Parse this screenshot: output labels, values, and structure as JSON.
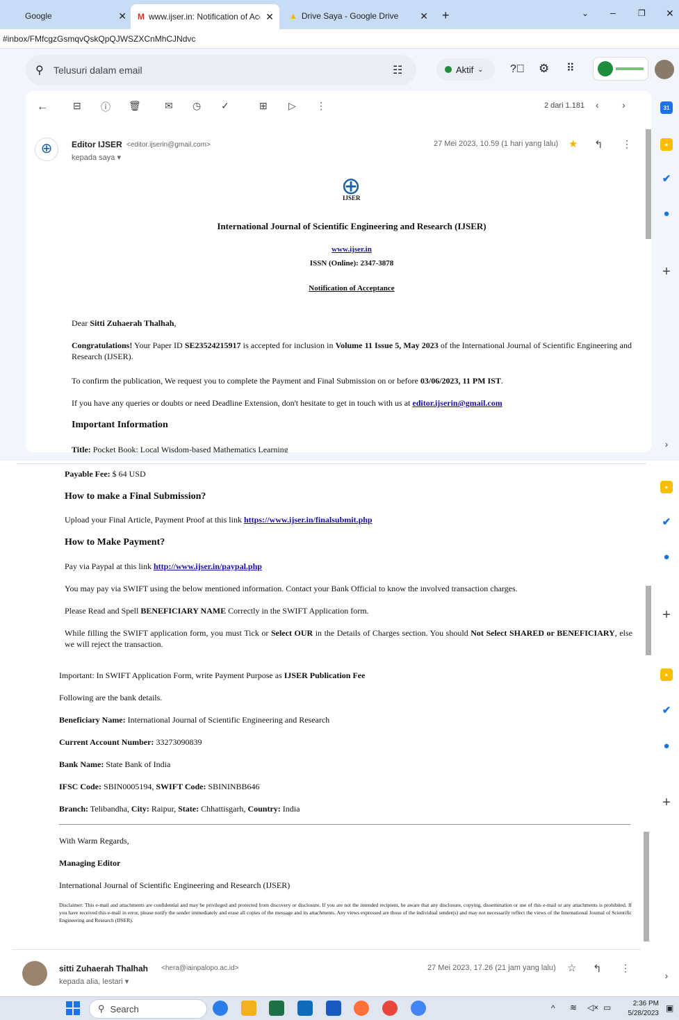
{
  "browser": {
    "tabs": [
      {
        "label": "Google"
      },
      {
        "label": "www.ijser.in: Notification of Acce"
      },
      {
        "label": "Drive Saya - Google Drive"
      }
    ],
    "url": "#inbox/FMfcgzGsmqvQskQpQJWSZXCnMhCJNdvc"
  },
  "gmail": {
    "search_placeholder": "Telusuri dalam email",
    "status": "Aktif",
    "pager": "2 dari 1.181"
  },
  "email": {
    "sender_name": "Editor IJSER",
    "sender_email": "<editor.ijserin@gmail.com>",
    "to": "kepada saya",
    "date": "27 Mei 2023, 10.59 (1 hari yang lalu)",
    "logo_text": "IJSER",
    "journal_title": "International Journal of Scientific Engineering and Research (IJSER)",
    "website": "www.ijser.in",
    "issn": "ISSN (Online): 2347-3878",
    "notice": "Notification of Acceptance",
    "dear_prefix": "Dear ",
    "dear_name": "Sitti Zuhaerah Thalhah",
    "dear_suffix": ",",
    "congrats_1": "Congratulations!",
    "congrats_2": " Your Paper ID ",
    "paper_id": "SE23524215917",
    "congrats_3": " is accepted for inclusion in ",
    "volume": "Volume 11 Issue 5, May 2023",
    "congrats_4": " of the International Journal of Scientific Engineering and Research (IJSER).",
    "confirm_1": "To confirm the publication, We request you to complete the Payment and Final Submission on or before ",
    "deadline": "03/06/2023, 11 PM IST",
    "confirm_2": ".",
    "queries_1": "If you have any queries or doubts or need Deadline Extension, don't hesitate to get in touch with us at ",
    "queries_email": "editor.ijserin@gmail.com",
    "important_heading": "Important Information",
    "title_label": "Title:",
    "title_value": " Pocket Book: Local Wisdom-based Mathematics Learning",
    "fee_label": "Payable Fee:",
    "fee_value": " $ 64 USD",
    "final_heading": "How to make a Final Submission?",
    "upload_text": "Upload your Final Article, Payment Proof at this link ",
    "upload_link": "https://www.ijser.in/finalsubmit.php",
    "payment_heading": "How to Make Payment?",
    "paypal_text": "Pay via Paypal at this link ",
    "paypal_link": "http://www.ijser.in/paypal.php",
    "swift_text": "You may pay via SWIFT using the below mentioned information. Contact your Bank Official to know the involved transaction charges.",
    "spell_1": "Please Read and Spell ",
    "spell_bold": "BENEFICIARY NAME",
    "spell_2": " Correctly in the SWIFT Application form.",
    "tick_1": "While filling the SWIFT application form, you must Tick or ",
    "tick_bold1": "Select OUR",
    "tick_2": " in the Details of Charges section. You should ",
    "tick_bold2": "Not Select SHARED or BENEFICIARY",
    "tick_3": ", else we will reject the transaction.",
    "purpose_1": "Important: In SWIFT Application Form, write Payment Purpose as ",
    "purpose_bold": "IJSER Publication Fee",
    "following": "Following are the bank details.",
    "ben_label": "Beneficiary Name:",
    "ben_value": " International Journal of Scientific Engineering and Research",
    "acc_label": "Current Account Number:",
    "acc_value": " 33273090839",
    "bank_label": "Bank Name:",
    "bank_value": " State Bank of India",
    "ifsc_label": "IFSC Code:",
    "ifsc_value": " SBIN0005194, ",
    "swift_label": "SWIFT Code:",
    "swift_value": " SBININBB646",
    "branch_label": "Branch:",
    "branch_value": " Telibandha, ",
    "city_label": "City:",
    "city_value": " Raipur, ",
    "state_label": "State:",
    "state_value": " Chhattisgarh, ",
    "country_label": "Country:",
    "country_value": " India",
    "regards": "With Warm Regards,",
    "signoff": "Managing Editor",
    "signoff_org": "International Journal of Scientific Engineering and Research (IJSER)",
    "disclaimer": "Disclaimer: This e-mail and attachments are confidential and may be privileged and protected from discovery or disclosure. If you are not the intended recipient, be aware that any disclosure, copying, dissemination or use of this e-mail or any attachments is prohibited. If you have received this e-mail in error, please notify the sender immediately and erase all copies of the message and its attachments. Any views expressed are those of the individual sender(s) and may not necessarily reflect the views of the International Journal of Scientific Engineering and Research (IJSER)."
  },
  "reply": {
    "sender_name": "sitti Zuhaerah Thalhah",
    "sender_email": "<hera@iainpalopo.ac.id>",
    "to": "kepada alia, lestari",
    "date": "27 Mei 2023, 17.26 (21 jam yang lalu)"
  },
  "taskbar": {
    "search": "Search",
    "time": "2:36 PM",
    "date": "5/28/2023"
  }
}
